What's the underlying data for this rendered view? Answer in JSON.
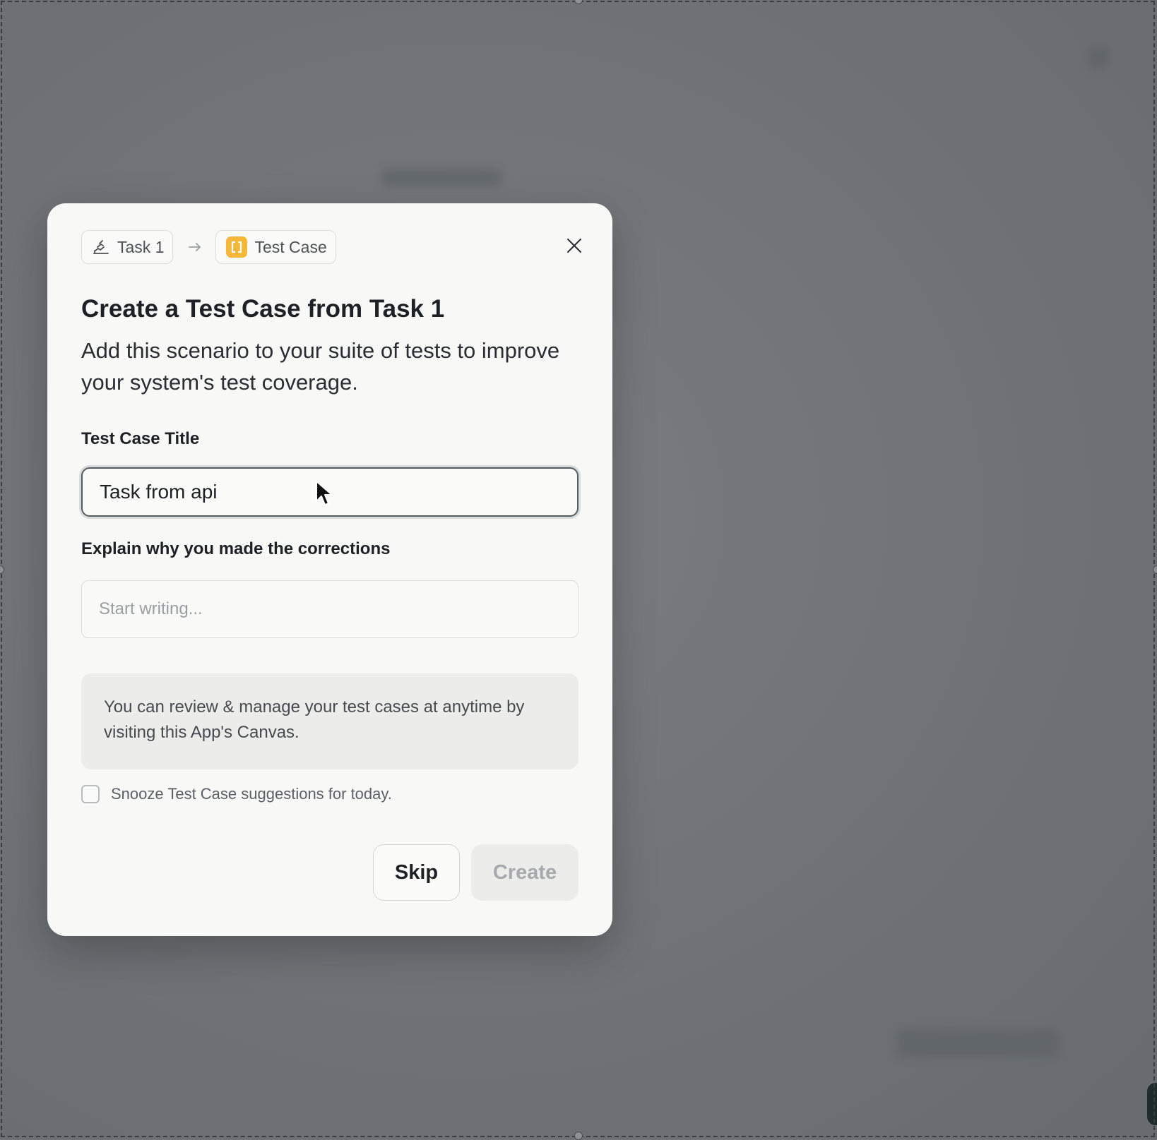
{
  "modal": {
    "breadcrumb": {
      "source_label": "Task 1",
      "target_label": "Test Case"
    },
    "title": "Create a Test Case from Task 1",
    "subtitle": "Add this scenario to your suite of tests to improve your system's test coverage.",
    "title_field": {
      "label": "Test Case Title",
      "value": "Task from api"
    },
    "notes_field": {
      "label": "Explain why you made the corrections",
      "placeholder": "Start writing..."
    },
    "info_text": "You can review & manage your test cases at anytime by visiting this App's Canvas.",
    "snooze": {
      "label": "Snooze Test Case suggestions for today.",
      "checked": false
    },
    "buttons": {
      "skip": "Skip",
      "create": "Create"
    }
  },
  "icons": {
    "task": "task-stack-icon",
    "test_case": "brackets-icon",
    "arrow": "arrow-right-icon",
    "close": "close-icon"
  },
  "colors": {
    "test_case_icon_bg": "#f5b63a",
    "overlay": "#707478",
    "modal_bg": "#f8f8f6"
  }
}
